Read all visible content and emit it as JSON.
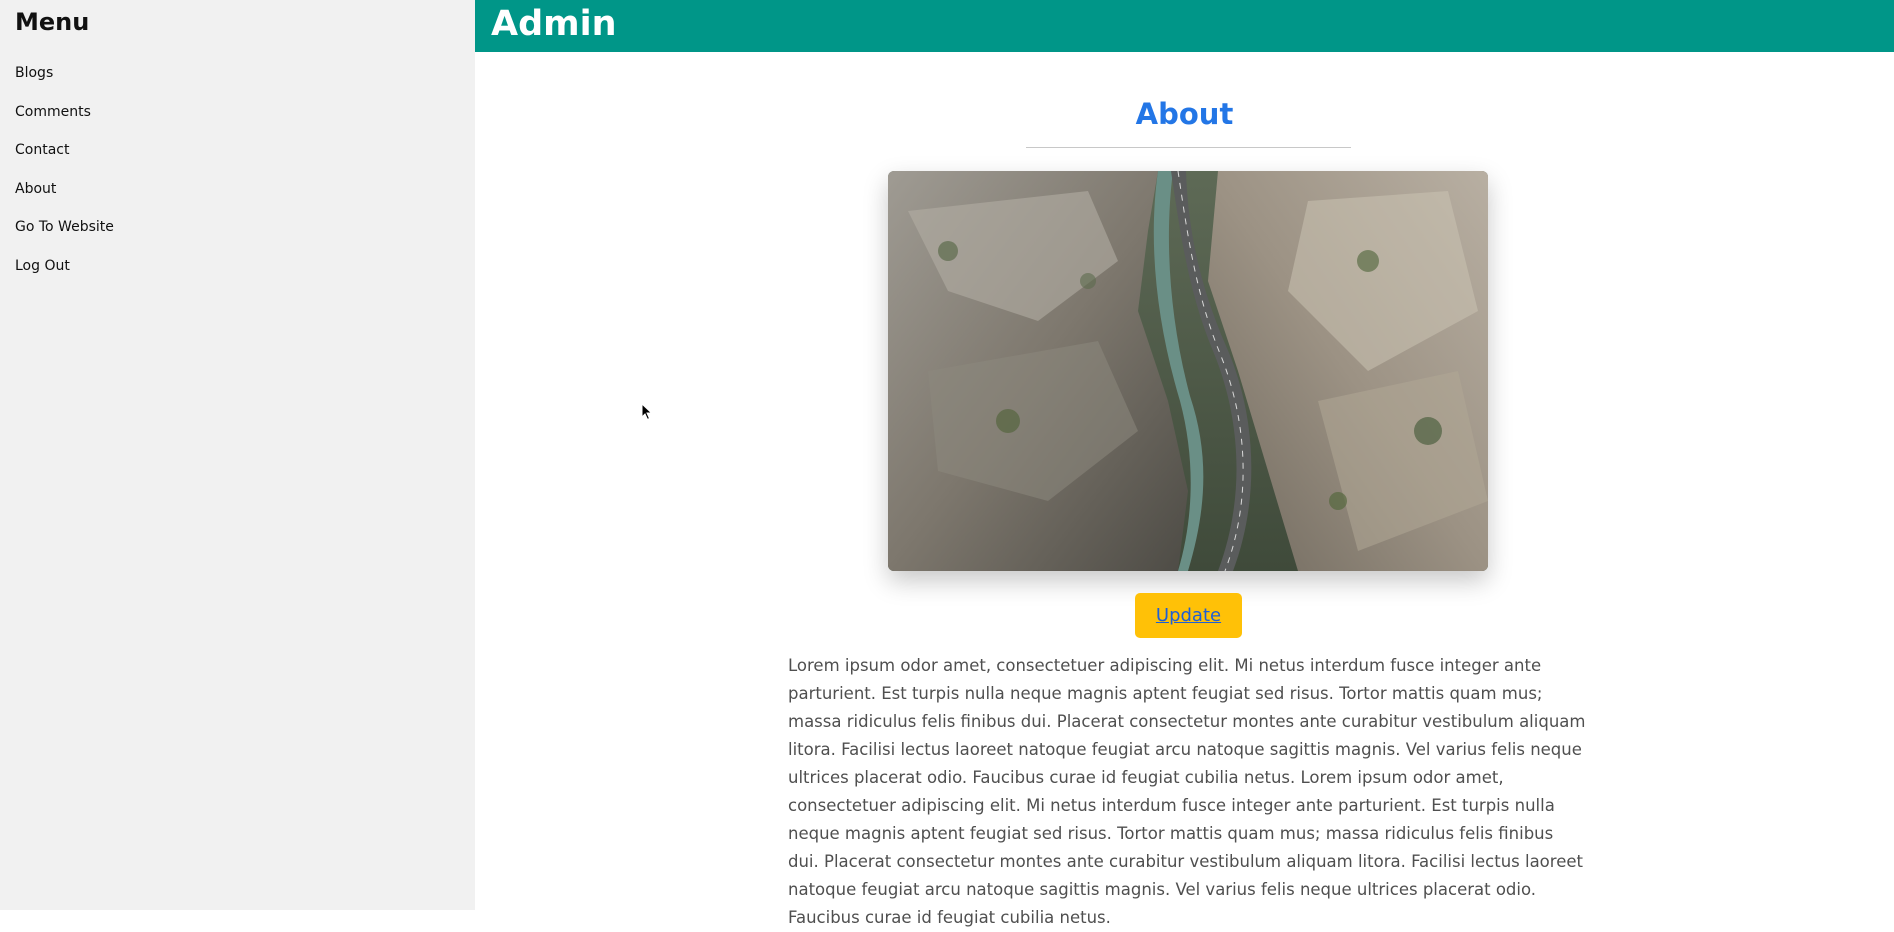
{
  "sidebar": {
    "title": "Menu",
    "items": [
      {
        "label": "Blogs"
      },
      {
        "label": "Comments"
      },
      {
        "label": "Contact"
      },
      {
        "label": "About"
      },
      {
        "label": "Go To Website"
      },
      {
        "label": "Log Out"
      }
    ]
  },
  "header": {
    "title": "Admin"
  },
  "main": {
    "heading": "About",
    "image": "canyon-road-photo",
    "update_label": "Update",
    "body_text": "Lorem ipsum odor amet, consectetuer adipiscing elit. Mi netus interdum fusce integer ante parturient. Est turpis nulla neque magnis aptent feugiat sed risus. Tortor mattis quam mus; massa ridiculus felis finibus dui. Placerat consectetur montes ante curabitur vestibulum aliquam litora. Facilisi lectus laoreet natoque feugiat arcu natoque sagittis magnis. Vel varius felis neque ultrices placerat odio. Faucibus curae id feugiat cubilia netus. Lorem ipsum odor amet, consectetuer adipiscing elit. Mi netus interdum fusce integer ante parturient. Est turpis nulla neque magnis aptent feugiat sed risus. Tortor mattis quam mus; massa ridiculus felis finibus dui. Placerat consectetur montes ante curabitur vestibulum aliquam litora. Facilisi lectus laoreet natoque feugiat arcu natoque sagittis magnis. Vel varius felis neque ultrices placerat odio. Faucibus curae id feugiat cubilia netus."
  },
  "colors": {
    "header_bg": "#009688",
    "sidebar_bg": "#f1f1f1",
    "heading": "#2376e6",
    "button_bg": "#ffc107"
  }
}
